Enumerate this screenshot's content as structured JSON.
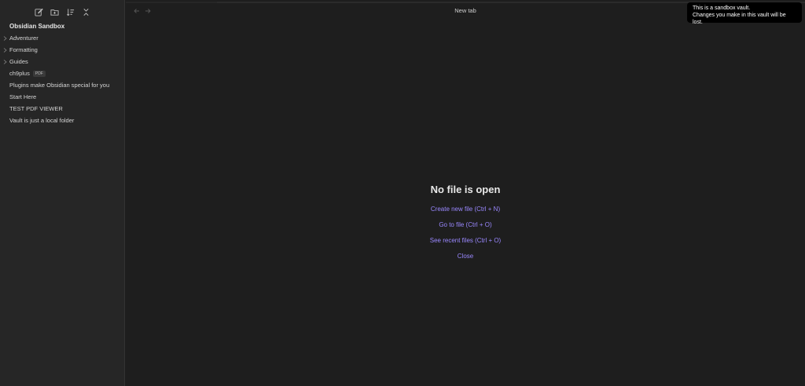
{
  "sidebar": {
    "toolbar": [
      {
        "name": "new-note-icon"
      },
      {
        "name": "new-folder-icon"
      },
      {
        "name": "sort-icon"
      },
      {
        "name": "collapse-all-icon"
      }
    ],
    "vault_name": "Obsidian Sandbox",
    "items": [
      {
        "label": "Adventurer",
        "folder": true
      },
      {
        "label": "Formatting",
        "folder": true
      },
      {
        "label": "Guides",
        "folder": true
      },
      {
        "label": "ch9plus",
        "badge": "PDF"
      },
      {
        "label": "Plugins make Obsidian special for you"
      },
      {
        "label": "Start Here"
      },
      {
        "label": "TEST PDF VIEWER"
      },
      {
        "label": "Vault is just a local folder"
      }
    ]
  },
  "main": {
    "tab_title": "New tab",
    "empty": {
      "title": "No file is open",
      "actions": [
        "Create new file (Ctrl + N)",
        "Go to file (Ctrl + O)",
        "See recent files (Ctrl + O)",
        "Close"
      ]
    }
  },
  "tooltip": {
    "line1": "This is a sandbox vault.",
    "line2": "Changes you make in this vault will be lost."
  },
  "colors": {
    "accent": "#9a88ff",
    "background": "#1e1e1e",
    "sidebar": "#262626"
  }
}
